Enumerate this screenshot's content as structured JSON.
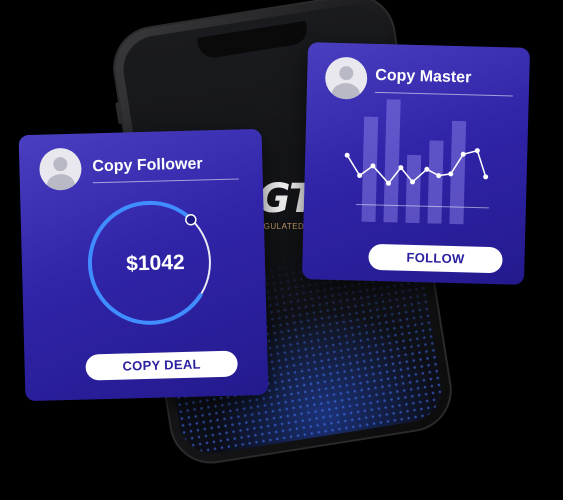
{
  "phone": {
    "logo_text": "RGTL",
    "logo_tagline": "TED | REGULATED | GLOB"
  },
  "copy_follower": {
    "title": "Copy Follower",
    "amount": "$1042",
    "button_label": "COPY DEAL",
    "progress": 0.78
  },
  "copy_master": {
    "title": "Copy Master",
    "button_label": "FOLLOW"
  },
  "colors": {
    "card": "#3024a8",
    "ring_progress": "#3f8dff",
    "button_text": "#2a20a0",
    "logo_tagline": "#c9a06a"
  }
}
